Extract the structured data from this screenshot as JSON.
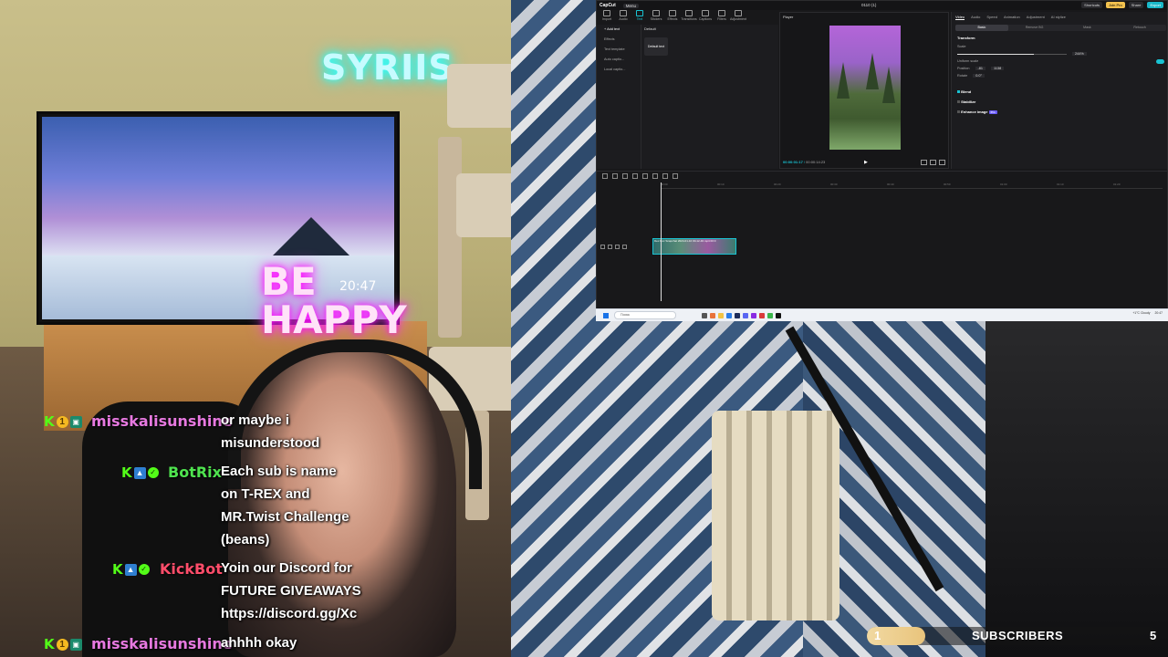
{
  "scene": {
    "neon_sign": "SYRIIS",
    "be_happy_line1": "BE",
    "be_happy_line2": "HAPPY",
    "tv_clock": "20:47"
  },
  "editor": {
    "logo": "CapCut",
    "menu_label": "Menu",
    "project_title": "0110 (1)",
    "titlebar_buttons": [
      "Shortcuts",
      "Join Pro",
      "Share",
      "Export"
    ],
    "toolbar": [
      {
        "label": "Import",
        "icon": "import-icon"
      },
      {
        "label": "Audio",
        "icon": "audio-icon"
      },
      {
        "label": "Text",
        "icon": "text-icon",
        "active": true
      },
      {
        "label": "Stickers",
        "icon": "sticker-icon"
      },
      {
        "label": "Effects",
        "icon": "effects-icon"
      },
      {
        "label": "Transitions",
        "icon": "transition-icon"
      },
      {
        "label": "Captions",
        "icon": "captions-icon"
      },
      {
        "label": "Filters",
        "icon": "filter-icon"
      },
      {
        "label": "Adjustment",
        "icon": "adjust-icon"
      }
    ],
    "left_nav": [
      "+ Add text",
      "Effects",
      "Text template",
      "Auto captio...",
      "Local captio..."
    ],
    "text_panel_heading": "Default",
    "text_card": "Default text",
    "player": {
      "title": "Player",
      "current_time": "00:00:01:17",
      "total_time": "00:00:14:23"
    },
    "props": {
      "tabs": [
        "Video",
        "Audio",
        "Speed",
        "Animation",
        "Adjustment",
        "AI stylize"
      ],
      "active_tab": "Video",
      "subtabs": [
        "Basic",
        "Remove BG",
        "Mask",
        "Retouch"
      ],
      "active_subtab": "Basic",
      "transform": "Transform",
      "scale_label": "Scale",
      "scale_value": "244%",
      "uniform_scale": "Uniform scale",
      "position_label": "Position",
      "pos_x": "-81",
      "pos_y": "1138",
      "rotate_label": "Rotate",
      "rotate_value": "0.0°",
      "blend": "Blend",
      "stabilize": "Stabilize",
      "enhance": "Enhance image",
      "enhance_badge": "Pro"
    },
    "timeline": {
      "ruler": [
        "00:00",
        "00:10",
        "00:20",
        "00:30",
        "00:40",
        "00:50",
        "01:00",
        "01:10",
        "01:20"
      ],
      "clip_label": "Dex  Doc  Snapchat 2024-01-10 00-12-46.mp4  00:0"
    },
    "taskbar": {
      "search_placeholder": "Поиск",
      "weather": "+1°C Cloudy",
      "clock": "20:47"
    }
  },
  "chat": [
    {
      "user": "misskalisunshine",
      "color": "#e779e0",
      "badges": [
        "kick",
        "coin",
        "gift"
      ],
      "text": "or maybe i\nmisunderstood"
    },
    {
      "user": "BotRix",
      "color": "#4fe34f",
      "badges": [
        "kick",
        "bot",
        "verified"
      ],
      "text": "Each sub is name\non T-REX and\nMR.Twist Challenge\n(beans)"
    },
    {
      "user": "KickBot",
      "color": "#ff4d6a",
      "badges": [
        "kick",
        "bot",
        "verified"
      ],
      "text": "Yoin our Discord for\nFUTURE GIVEAWAYS\nhttps://discord.gg/Xc"
    },
    {
      "user": "misskalisunshine",
      "color": "#e779e0",
      "badges": [
        "kick",
        "coin",
        "gift"
      ],
      "text": "ahhhh okay"
    }
  ],
  "subscribers": {
    "current": "1",
    "label": "SUBSCRIBERS",
    "goal": "5",
    "progress_fraction": 0.2
  }
}
